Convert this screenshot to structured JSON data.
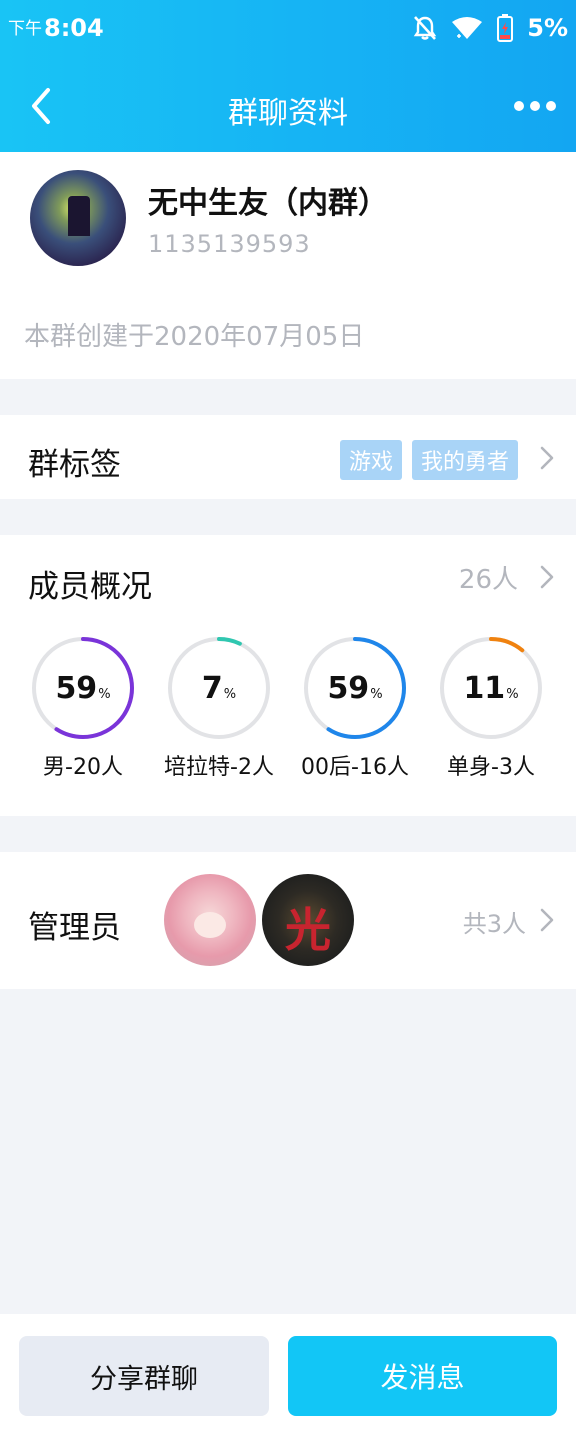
{
  "status_bar": {
    "ampm": "下午",
    "time": "8:04",
    "battery": "5%",
    "icons": [
      "bell-off-icon",
      "wifi-icon",
      "battery-low-icon"
    ]
  },
  "nav": {
    "title": "群聊资料",
    "back_icon": "back-chevron-icon",
    "more_icon": "more-dots-icon"
  },
  "group": {
    "name": "无中生友（内群）",
    "id": "1135139593",
    "created": "本群创建于2020年07月05日"
  },
  "tags": {
    "label": "群标签",
    "items": [
      "游戏",
      "我的勇者"
    ]
  },
  "members": {
    "label": "成员概况",
    "count": "26人",
    "stats": [
      {
        "value": "59",
        "pct": "%",
        "label": "男-20人",
        "fraction": 0.59,
        "color": "#7a34d9"
      },
      {
        "value": "7",
        "pct": "%",
        "label": "培拉特-2人",
        "fraction": 0.07,
        "color": "#2fc7b0"
      },
      {
        "value": "59",
        "pct": "%",
        "label": "00后-16人",
        "fraction": 0.59,
        "color": "#1f86ea"
      },
      {
        "value": "11",
        "pct": "%",
        "label": "单身-3人",
        "fraction": 0.11,
        "color": "#f0820f"
      }
    ]
  },
  "admins": {
    "label": "管理员",
    "count": "共3人"
  },
  "actions": {
    "share": "分享群聊",
    "send": "发消息"
  }
}
